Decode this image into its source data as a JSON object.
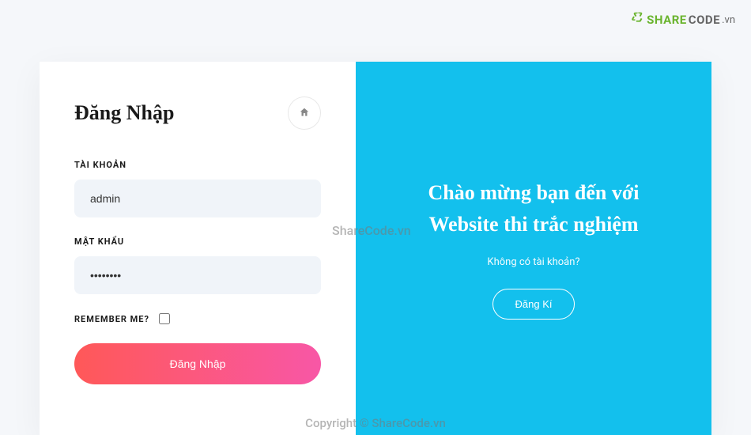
{
  "logo": {
    "text1": "SHARE",
    "text2": "CODE",
    "text3": ".vn"
  },
  "login": {
    "title": "Đăng Nhập",
    "username_label": "TÀI KHOẢN",
    "username_value": "admin",
    "password_label": "MẬT KHẨU",
    "password_value": "••••••••",
    "remember_label": "REMEMBER ME?",
    "submit_label": "Đăng Nhập"
  },
  "welcome": {
    "title_line1": "Chào mừng bạn đến với",
    "title_line2": "Website thi trắc nghiệm",
    "subtitle": "Không có tài khoản?",
    "register_label": "Đăng Kí"
  },
  "watermark": {
    "center": "ShareCode.vn",
    "bottom": "Copyright © ShareCode.vn"
  }
}
